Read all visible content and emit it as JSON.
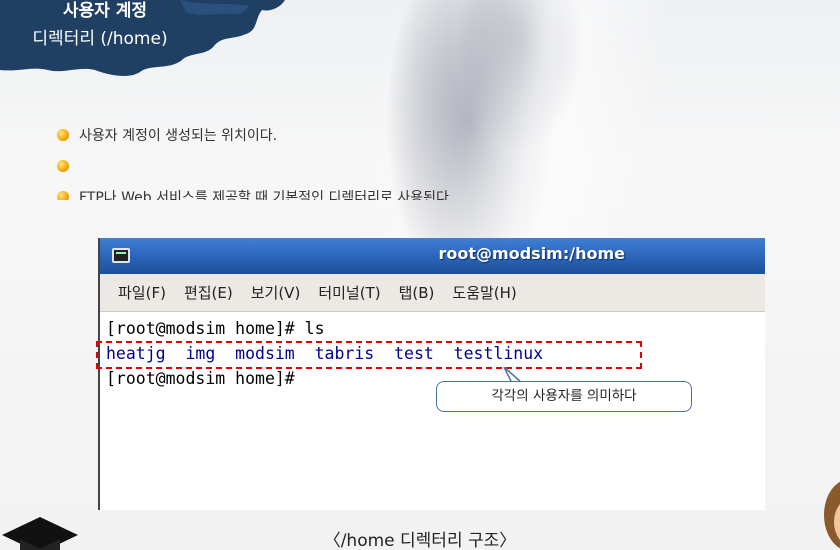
{
  "header": {
    "line1": "사용자 계정",
    "line2": "디렉터리 (/home)"
  },
  "bullets": [
    "사용자 계정이 생성되는 위치이다.",
    "",
    "FTP나 Web 서비스를 제공할 때 기본적인 디렉터리로 사용된다"
  ],
  "terminal": {
    "title": "root@modsim:/home",
    "menu": [
      "파일(F)",
      "편집(E)",
      "보기(V)",
      "터미널(T)",
      "탭(B)",
      "도움말(H)"
    ],
    "lines": [
      "[root@modsim home]# ls",
      "heatjg  img  modsim  tabris  test  testlinux",
      "[root@modsim home]#"
    ]
  },
  "callout": "각각의 사용자를 의미하다",
  "caption": "〈/home 디렉터리 구조〉",
  "colors": {
    "titlebar": "#2a64b8",
    "header_blob": "#1f3f63",
    "highlight": "#e00000",
    "ls_text": "#00008f",
    "bullet": "#f5a300"
  }
}
